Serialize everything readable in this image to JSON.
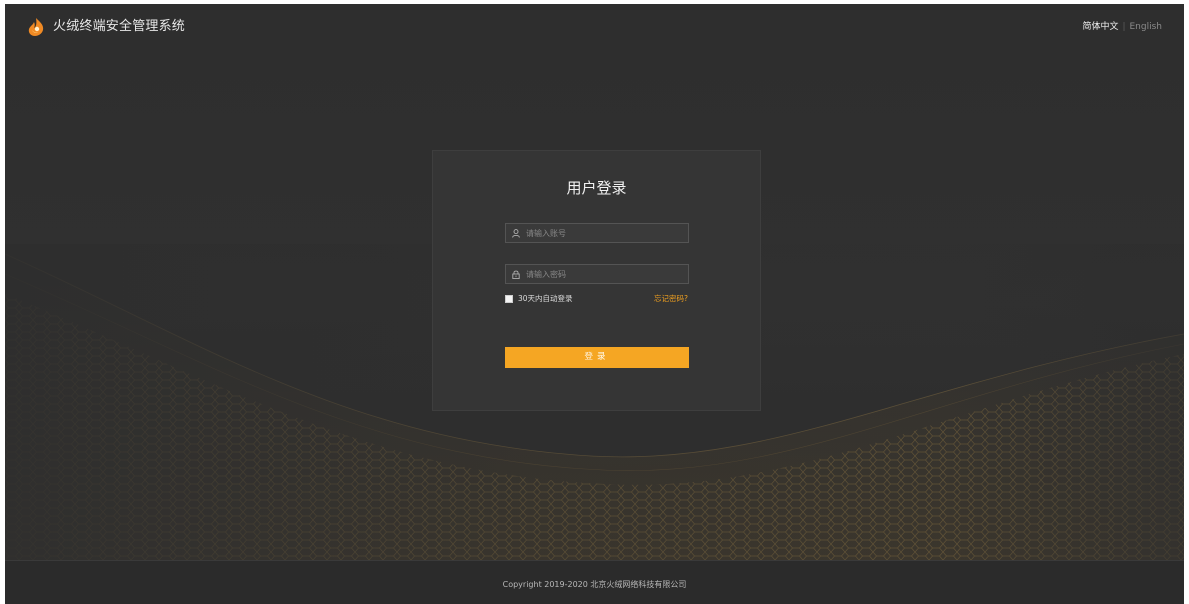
{
  "header": {
    "app_title": "火绒终端安全管理系统",
    "lang_zh": "简体中文",
    "lang_separator": "|",
    "lang_en": "English"
  },
  "login": {
    "title": "用户登录",
    "username_placeholder": "请输入账号",
    "password_placeholder": "请输入密码",
    "remember_label": "30天内自动登录",
    "remember_checked": false,
    "forgot_label": "忘记密码?",
    "submit_label": "登录"
  },
  "footer": {
    "copyright": "Copyright 2019-2020 北京火绒网络科技有限公司"
  },
  "colors": {
    "accent": "#f5a623",
    "background": "#2e2e2e",
    "card": "#363636"
  },
  "icons": {
    "logo": "huorong-logo-icon",
    "user": "user-icon",
    "lock": "lock-icon"
  }
}
